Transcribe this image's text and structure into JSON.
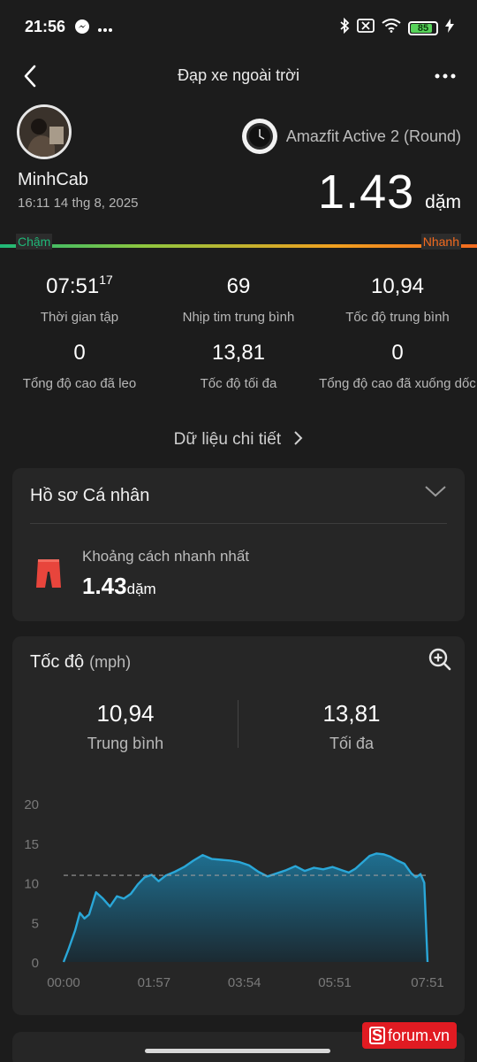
{
  "status_bar": {
    "time": "21:56",
    "battery_percent": "85",
    "battery_level": 0.85,
    "icons": [
      "messenger-icon",
      "more-dots-icon",
      "bluetooth-icon",
      "no-sim-icon",
      "wifi-icon",
      "battery-icon",
      "charging-icon"
    ]
  },
  "header": {
    "title": "Đạp xe ngoài trời"
  },
  "profile": {
    "username": "MinhCab",
    "datetime": "16:11 14 thg 8, 2025"
  },
  "device": {
    "name": "Amazfit Active 2 (Round)"
  },
  "distance": {
    "value": "1.43",
    "unit": "dặm"
  },
  "pace_bar": {
    "slow": "Chậm",
    "fast": "Nhanh",
    "colors": [
      "#1fb878",
      "#8ec63f",
      "#f0a020",
      "#f26a1f"
    ]
  },
  "stats": [
    {
      "value": "07:51",
      "sup": "17",
      "label": "Thời gian tập"
    },
    {
      "value": "69",
      "sup": "",
      "label": "Nhịp tim trung bình"
    },
    {
      "value": "10,94",
      "sup": "",
      "label": "Tốc độ trung bình"
    },
    {
      "value": "0",
      "sup": "",
      "label": "Tổng độ cao đã leo"
    },
    {
      "value": "13,81",
      "sup": "",
      "label": "Tốc độ tối đa"
    },
    {
      "value": "0",
      "sup": "",
      "label": "Tổng độ cao đã xuống dốc"
    }
  ],
  "detail_link": {
    "label": "Dữ liệu chi tiết"
  },
  "personal_record": {
    "title": "Hồ sơ Cá nhân",
    "record_label": "Khoảng cách nhanh nhất",
    "record_value": "1.43",
    "record_unit": "dặm"
  },
  "speed_card": {
    "title": "Tốc độ",
    "unit": "(mph)",
    "avg_value": "10,94",
    "avg_label": "Trung bình",
    "max_value": "13,81",
    "max_label": "Tối đa"
  },
  "chart_data": {
    "type": "area",
    "title": "Tốc độ",
    "ylabel": "(mph)",
    "ylim": [
      0,
      20
    ],
    "yticks": [
      "20",
      "15",
      "10",
      "5",
      "0"
    ],
    "xticks": [
      "00:00",
      "01:57",
      "03:54",
      "05:51",
      "07:51"
    ],
    "average": 10.94,
    "color": "#2aa7d8",
    "grid": false,
    "x_minutes": [
      0,
      0.1,
      0.25,
      0.35,
      0.45,
      0.55,
      0.7,
      0.85,
      1.0,
      1.15,
      1.3,
      1.45,
      1.6,
      1.75,
      1.9,
      2.05,
      2.2,
      2.4,
      2.6,
      2.8,
      3.0,
      3.2,
      3.4,
      3.6,
      3.8,
      4.0,
      4.2,
      4.4,
      4.6,
      4.8,
      5.0,
      5.2,
      5.4,
      5.6,
      5.8,
      6.0,
      6.15,
      6.3,
      6.45,
      6.6,
      6.75,
      6.9,
      7.05,
      7.2,
      7.35,
      7.5,
      7.6,
      7.7,
      7.78,
      7.85
    ],
    "y_mph": [
      0,
      1.5,
      4.0,
      6.2,
      5.5,
      6.0,
      8.8,
      8.0,
      7.0,
      8.3,
      8.0,
      8.6,
      9.8,
      10.7,
      11.0,
      10.2,
      10.9,
      11.4,
      12.0,
      12.8,
      13.5,
      13.0,
      12.9,
      12.8,
      12.6,
      12.2,
      11.4,
      10.8,
      11.2,
      11.6,
      12.1,
      11.5,
      11.9,
      11.7,
      12.0,
      11.6,
      11.3,
      11.8,
      12.6,
      13.4,
      13.7,
      13.6,
      13.3,
      12.8,
      12.4,
      11.2,
      10.7,
      11.1,
      10.0,
      0
    ]
  },
  "watermark": {
    "letter": "S",
    "text": "forum.vn"
  }
}
